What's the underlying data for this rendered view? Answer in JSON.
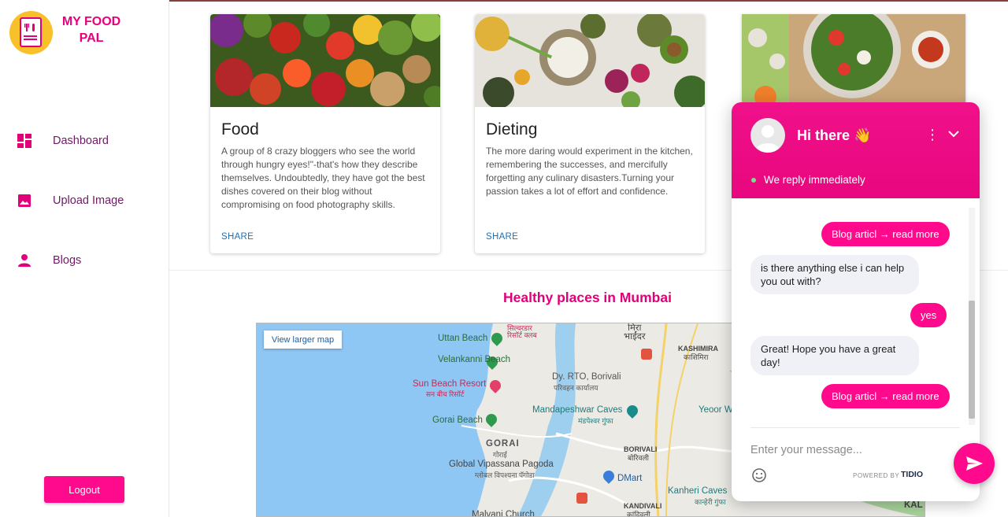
{
  "app": {
    "name": "MY FOOD PAL"
  },
  "sidebar": {
    "items": [
      {
        "label": "Dashboard",
        "icon": "dashboard-icon"
      },
      {
        "label": "Upload Image",
        "icon": "image-icon"
      },
      {
        "label": "Blogs",
        "icon": "person-icon"
      }
    ],
    "logout_label": "Logout"
  },
  "cards": [
    {
      "title": "Food",
      "description": "A group of 8 crazy bloggers who see the world through hungry eyes!\"-that's how they describe themselves. Undoubtedly, they have got the best dishes covered on their blog without compromising on food photography skills.",
      "action": "SHARE"
    },
    {
      "title": "Dieting",
      "description": "The more daring would experiment in the kitchen, remembering the successes, and mercifully forgetting any culinary disasters.Turning your passion takes a lot of effort and confidence.",
      "action": "SHARE"
    }
  ],
  "map_section": {
    "title": "Healthy places in Mumbai",
    "view_larger": "View larger map",
    "labels": {
      "uttan": "Uttan Beach",
      "velankanni": "Velankanni Beach",
      "sun_beach": "Sun Beach Resort",
      "sun_beach_hi": "सन बीच रिसॉर्ट",
      "gorai_beach": "Gorai Beach",
      "gorai": "GORAI",
      "gorai_hi": "गोराई",
      "pagoda": "Global Vipassana Pagoda",
      "pagoda_hi": "ग्लोबल विपश्यना पॅगोडा",
      "dy_rto": "Dy. RTO, Borivali",
      "dy_rto_hi": "परिवहन कार्यालय",
      "mandapeshwar": "Mandapeshwar Caves",
      "mandapeshwar_hi": "मंडपेश्वर गुंफा",
      "borivali": "BORIVALI",
      "borivali_hi": "बोरिवली",
      "dmart": "DMart",
      "kandivali": "KANDIVALI",
      "kandivali_hi": "कांदिवली",
      "kanheri": "Kanheri Caves",
      "kanheri_hi": "कान्हेरी गुंफा",
      "yeoor": "Yeoor W",
      "kashimira": "KASHIMIRA",
      "kashimira_hi": "काशिमिरा",
      "mira": "मिरा",
      "bhayandar": "भाईंदर",
      "malvani": "Malvani Church",
      "kal": "KAL",
      "silver": "सिल्वरडार",
      "silver2": "रिसॉर्ट क्लब"
    }
  },
  "chat": {
    "greeting": "Hi there 👋",
    "status": "We reply immediately",
    "messages": [
      {
        "from": "bot",
        "text": "Blog articl → read more"
      },
      {
        "from": "bot_q",
        "text": "is there anything else i can help you out with?"
      },
      {
        "from": "user",
        "text": "yes"
      },
      {
        "from": "bot_q",
        "text": "Great! Hope you have a great day!"
      },
      {
        "from": "bot",
        "text": "Blog articl → read more"
      }
    ],
    "input_placeholder": "Enter your message...",
    "powered_by": "POWERED BY",
    "brand": "TIDIO"
  },
  "colors": {
    "accent": "#ff0a8c",
    "brand_text": "#e8007d",
    "nav_text": "#6f1a64",
    "logo_bg": "#f8c12b"
  }
}
